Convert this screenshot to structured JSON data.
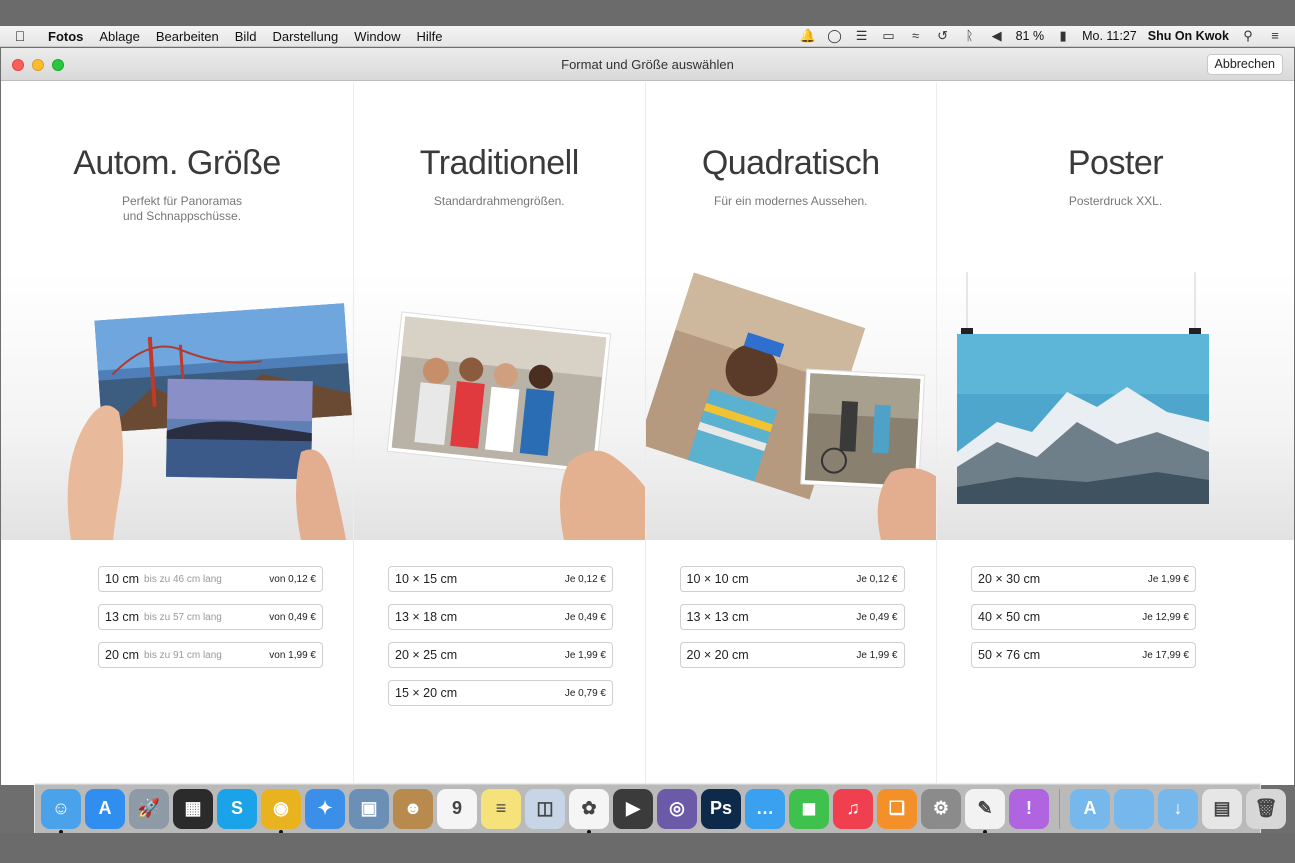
{
  "menubar": {
    "app_name": "Fotos",
    "items": [
      "Ablage",
      "Bearbeiten",
      "Bild",
      "Darstellung",
      "Window",
      "Hilfe"
    ],
    "battery": "81 %",
    "clock": "Mo. 11:27",
    "user": "Shu On Kwok"
  },
  "window": {
    "title": "Format und Größe auswählen",
    "cancel_label": "Abbrechen"
  },
  "columns": [
    {
      "title": "Autom. Größe",
      "subtitle": "Perfekt für Panoramas und Schnappschüsse.",
      "sizes": [
        {
          "size": "10 cm",
          "extra": "bis zu 46 cm lang",
          "price": "von 0,12 €"
        },
        {
          "size": "13 cm",
          "extra": "bis zu 57 cm lang",
          "price": "von 0,49 €"
        },
        {
          "size": "20 cm",
          "extra": "bis zu 91 cm lang",
          "price": "von 1,99 €"
        }
      ]
    },
    {
      "title": "Traditionell",
      "subtitle": "Standardrahmengrößen.",
      "sizes": [
        {
          "size": "10 × 15 cm",
          "extra": "",
          "price": "Je 0,12 €"
        },
        {
          "size": "13 × 18 cm",
          "extra": "",
          "price": "Je 0,49 €"
        },
        {
          "size": "20 × 25 cm",
          "extra": "",
          "price": "Je 1,99 €"
        },
        {
          "size": "15 × 20 cm",
          "extra": "",
          "price": "Je 0,79 €"
        }
      ]
    },
    {
      "title": "Quadratisch",
      "subtitle": "Für ein modernes Aussehen.",
      "sizes": [
        {
          "size": "10 × 10 cm",
          "extra": "",
          "price": "Je 0,12 €"
        },
        {
          "size": "13 × 13 cm",
          "extra": "",
          "price": "Je 0,49 €"
        },
        {
          "size": "20 × 20 cm",
          "extra": "",
          "price": "Je 1,99 €"
        }
      ]
    },
    {
      "title": "Poster",
      "subtitle": "Posterdruck XXL.",
      "sizes": [
        {
          "size": "20 × 30 cm",
          "extra": "",
          "price": "Je 1,99 €"
        },
        {
          "size": "40 × 50 cm",
          "extra": "",
          "price": "Je 12,99 €"
        },
        {
          "size": "50 × 76 cm",
          "extra": "",
          "price": "Je 17,99 €"
        }
      ]
    }
  ],
  "dock": {
    "apps": [
      {
        "name": "finder-icon",
        "color": "#4aa3ea",
        "glyph": "☺",
        "running": true
      },
      {
        "name": "app-store-icon",
        "color": "#2f8ef0",
        "glyph": "A",
        "running": false
      },
      {
        "name": "launchpad-icon",
        "color": "#8e9aa6",
        "glyph": "🚀",
        "running": false
      },
      {
        "name": "mission-control-icon",
        "color": "#2b2b2b",
        "glyph": "▦",
        "running": false
      },
      {
        "name": "skype-icon",
        "color": "#1aa3e8",
        "glyph": "S",
        "running": false
      },
      {
        "name": "chrome-icon",
        "color": "#e9b21f",
        "glyph": "◉",
        "running": true
      },
      {
        "name": "safari-icon",
        "color": "#3c8fe8",
        "glyph": "✦",
        "running": false
      },
      {
        "name": "preview-icon",
        "color": "#6b8fb5",
        "glyph": "▣",
        "running": false
      },
      {
        "name": "contacts-icon",
        "color": "#b88a4e",
        "glyph": "☻",
        "running": false
      },
      {
        "name": "calendar-icon",
        "color": "#f5f5f5",
        "glyph": "9",
        "running": false
      },
      {
        "name": "notes-icon",
        "color": "#f6e27a",
        "glyph": "≡",
        "running": false
      },
      {
        "name": "image-capture-icon",
        "color": "#c6d6e6",
        "glyph": "◫",
        "running": false
      },
      {
        "name": "photos-icon",
        "color": "#f5f5f5",
        "glyph": "✿",
        "running": true
      },
      {
        "name": "final-cut-icon",
        "color": "#3b3b3b",
        "glyph": "▶",
        "running": false
      },
      {
        "name": "motion-icon",
        "color": "#6b5aa8",
        "glyph": "◎",
        "running": false
      },
      {
        "name": "photoshop-icon",
        "color": "#0d2a4a",
        "glyph": "Ps",
        "running": false
      },
      {
        "name": "messages-icon",
        "color": "#3aa0f0",
        "glyph": "…",
        "running": false
      },
      {
        "name": "facetime-icon",
        "color": "#3fc24d",
        "glyph": "◼",
        "running": false
      },
      {
        "name": "itunes-icon",
        "color": "#f0404f",
        "glyph": "♫",
        "running": false
      },
      {
        "name": "ibooks-icon",
        "color": "#f3902a",
        "glyph": "❑",
        "running": false
      },
      {
        "name": "system-preferences-icon",
        "color": "#8b8b8b",
        "glyph": "⚙",
        "running": false
      },
      {
        "name": "textedit-icon",
        "color": "#f2f2f2",
        "glyph": "✎",
        "running": true
      },
      {
        "name": "feedback-icon",
        "color": "#b064e0",
        "glyph": "!",
        "running": false
      }
    ],
    "folders": [
      {
        "name": "applications-folder-icon",
        "color": "#76b8ec",
        "glyph": "A"
      },
      {
        "name": "documents-folder-icon",
        "color": "#76b8ec",
        "glyph": ""
      },
      {
        "name": "downloads-folder-icon",
        "color": "#76b8ec",
        "glyph": "↓"
      },
      {
        "name": "recent-stack-icon",
        "color": "#e6e6e6",
        "glyph": "▤"
      },
      {
        "name": "trash-icon",
        "color": "#d7d7d7",
        "glyph": "🗑"
      }
    ]
  }
}
